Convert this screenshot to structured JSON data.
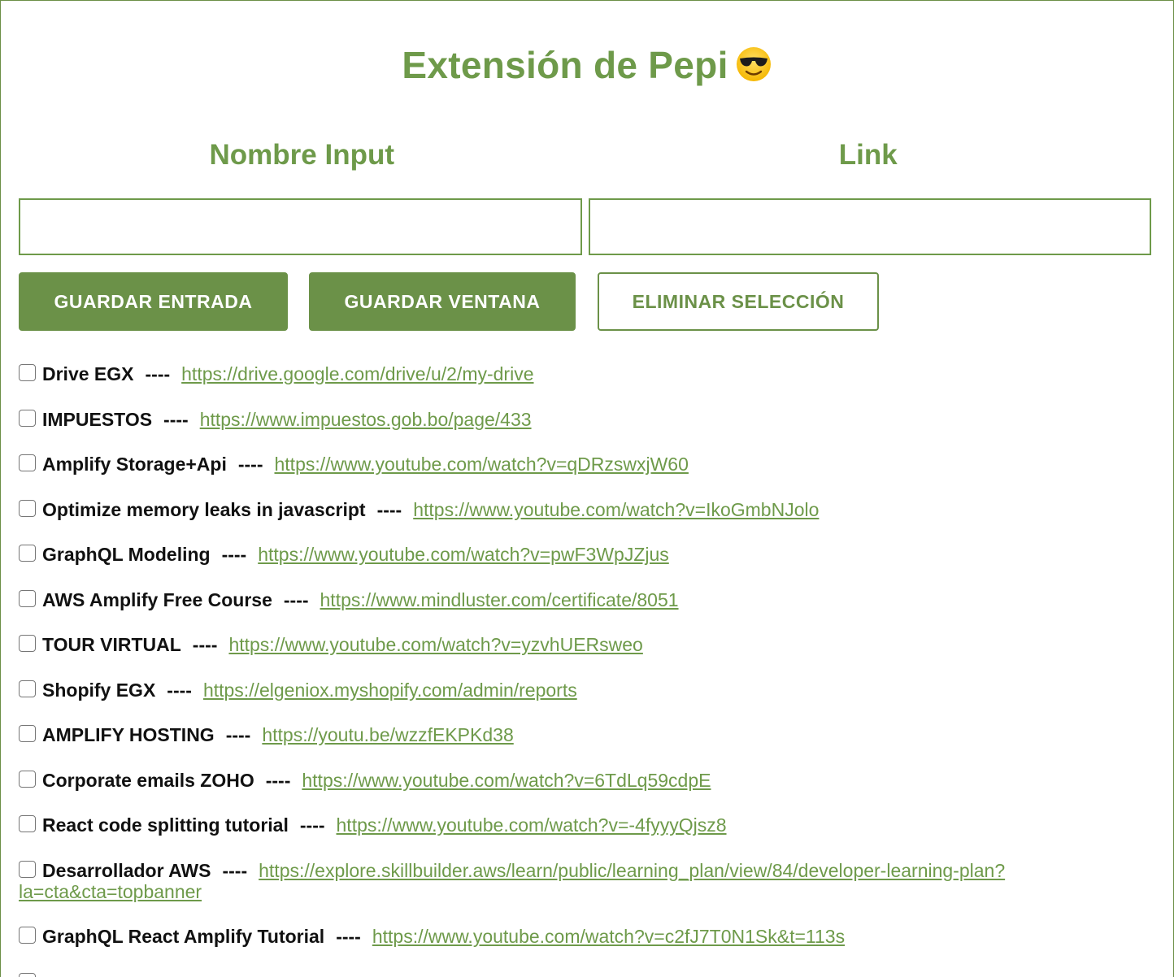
{
  "title": "Extensión de Pepi",
  "title_emoji": "smiling-face-with-sunglasses-icon",
  "columns": {
    "name_header": "Nombre Input",
    "link_header": "Link"
  },
  "inputs": {
    "name_value": "",
    "name_placeholder": "",
    "link_value": "",
    "link_placeholder": ""
  },
  "buttons": {
    "save_entry": "GUARDAR ENTRADA",
    "save_window": "GUARDAR VENTANA",
    "delete_selection": "ELIMINAR SELECCIÓN"
  },
  "separator": "----",
  "colors": {
    "accent": "#6e9a4a",
    "button_fill": "#6b9148"
  },
  "entries": [
    {
      "name": "Drive EGX",
      "url": "https://drive.google.com/drive/u/2/my-drive",
      "checked": false
    },
    {
      "name": "IMPUESTOS",
      "url": "https://www.impuestos.gob.bo/page/433",
      "checked": false
    },
    {
      "name": "Amplify Storage+Api",
      "url": "https://www.youtube.com/watch?v=qDRzswxjW60",
      "checked": false
    },
    {
      "name": "Optimize memory leaks in javascript",
      "url": "https://www.youtube.com/watch?v=IkoGmbNJolo",
      "checked": false
    },
    {
      "name": "GraphQL Modeling",
      "url": "https://www.youtube.com/watch?v=pwF3WpJZjus",
      "checked": false
    },
    {
      "name": "AWS Amplify Free Course",
      "url": "https://www.mindluster.com/certificate/8051",
      "checked": false
    },
    {
      "name": "TOUR VIRTUAL",
      "url": "https://www.youtube.com/watch?v=yzvhUERsweo",
      "checked": false
    },
    {
      "name": "Shopify EGX",
      "url": "https://elgeniox.myshopify.com/admin/reports",
      "checked": false
    },
    {
      "name": "AMPLIFY HOSTING",
      "url": "https://youtu.be/wzzfEKPKd38",
      "checked": false
    },
    {
      "name": "Corporate emails ZOHO",
      "url": "https://www.youtube.com/watch?v=6TdLq59cdpE",
      "checked": false
    },
    {
      "name": "React code splitting tutorial",
      "url": "https://www.youtube.com/watch?v=-4fyyyQjsz8",
      "checked": false
    },
    {
      "name": "Desarrollador AWS",
      "url": "https://explore.skillbuilder.aws/learn/public/learning_plan/view/84/developer-learning-plan?la=cta&cta=topbanner",
      "checked": false
    },
    {
      "name": "GraphQL React Amplify Tutorial",
      "url": "https://www.youtube.com/watch?v=c2fJ7T0N1Sk&t=113s",
      "checked": false
    }
  ]
}
